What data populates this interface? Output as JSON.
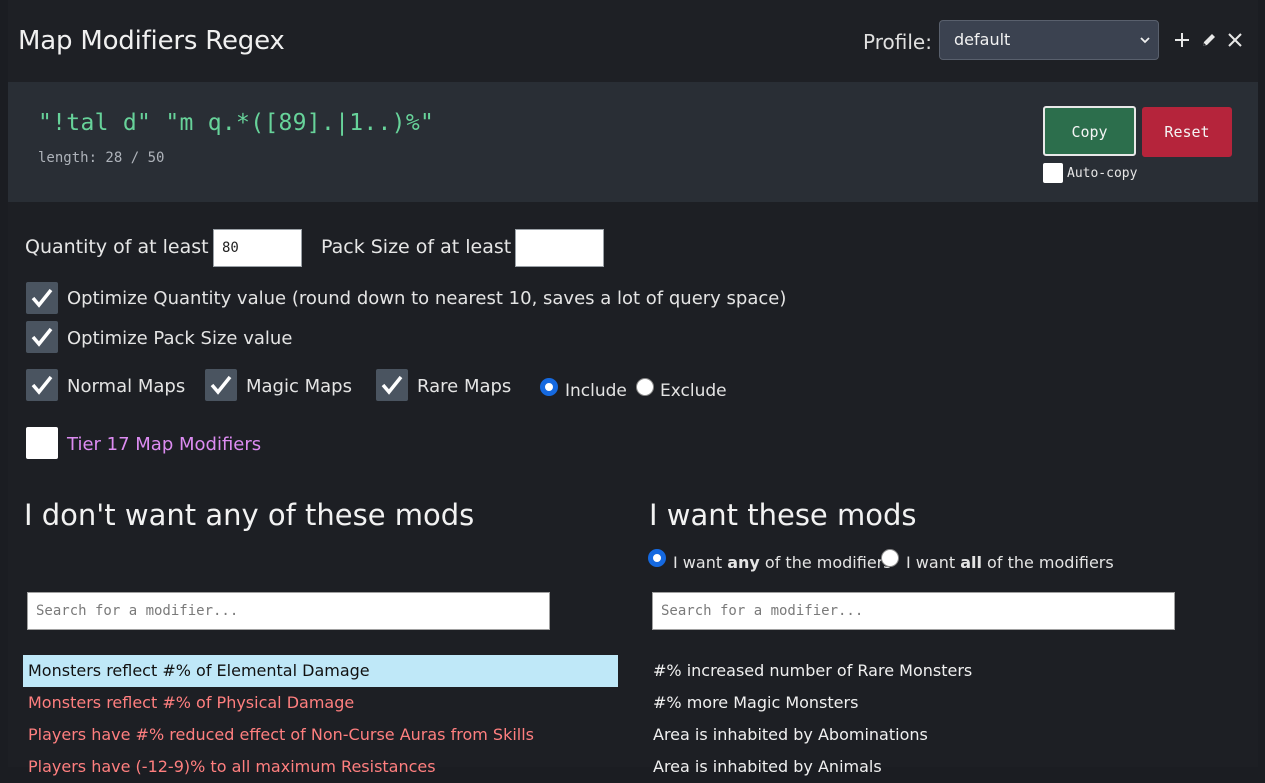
{
  "header": {
    "title": "Map Modifiers Regex",
    "profile_label": "Profile:",
    "profile_value": "default"
  },
  "regex": {
    "text": "\"!tal d\" \"m q.*([89].|1..)%\"",
    "length": "length: 28 / 50",
    "copy_label": "Copy",
    "reset_label": "Reset",
    "autocopy_label": "Auto-copy",
    "autocopy_checked": false
  },
  "settings": {
    "quantity_label": "Quantity of at least",
    "quantity_value": "80",
    "pack_label": "Pack Size of at least",
    "pack_value": "",
    "optimize_quantity": "Optimize Quantity value (round down to nearest 10, saves a lot of query space)",
    "optimize_pack": "Optimize Pack Size value",
    "normal_maps": "Normal Maps",
    "magic_maps": "Magic Maps",
    "rare_maps": "Rare Maps",
    "include": "Include",
    "exclude": "Exclude",
    "tier17": "Tier 17 Map Modifiers"
  },
  "exclude_col": {
    "title": "I don't want any of these mods",
    "search_placeholder": "Search for a modifier...",
    "mods": [
      "Monsters reflect #% of Elemental Damage",
      "Monsters reflect #% of Physical Damage",
      "Players have #% reduced effect of Non-Curse Auras from Skills",
      "Players have (-12-9)% to all maximum Resistances"
    ]
  },
  "include_col": {
    "title": "I want these mods",
    "any_pre": "I want ",
    "any_bold": "any",
    "any_post": " of the modifiers",
    "all_pre": "I want ",
    "all_bold": "all",
    "all_post": " of the modifiers",
    "search_placeholder": "Search for a modifier...",
    "mods": [
      "#% increased number of Rare Monsters",
      "#% more Magic Monsters",
      "Area is inhabited by Abominations",
      "Area is inhabited by Animals"
    ]
  },
  "colors": {
    "accent_green": "#67d39a",
    "copy_bg": "#2c6e4c",
    "reset_bg": "#b5243b",
    "excluded_mod": "#ff7f7f",
    "highlight": "#bfe8f8",
    "tier17": "#dd8cf2"
  },
  "icons": {
    "add": "plus-icon",
    "edit": "pencil-icon",
    "delete": "close-icon",
    "check": "checkmark-icon"
  }
}
